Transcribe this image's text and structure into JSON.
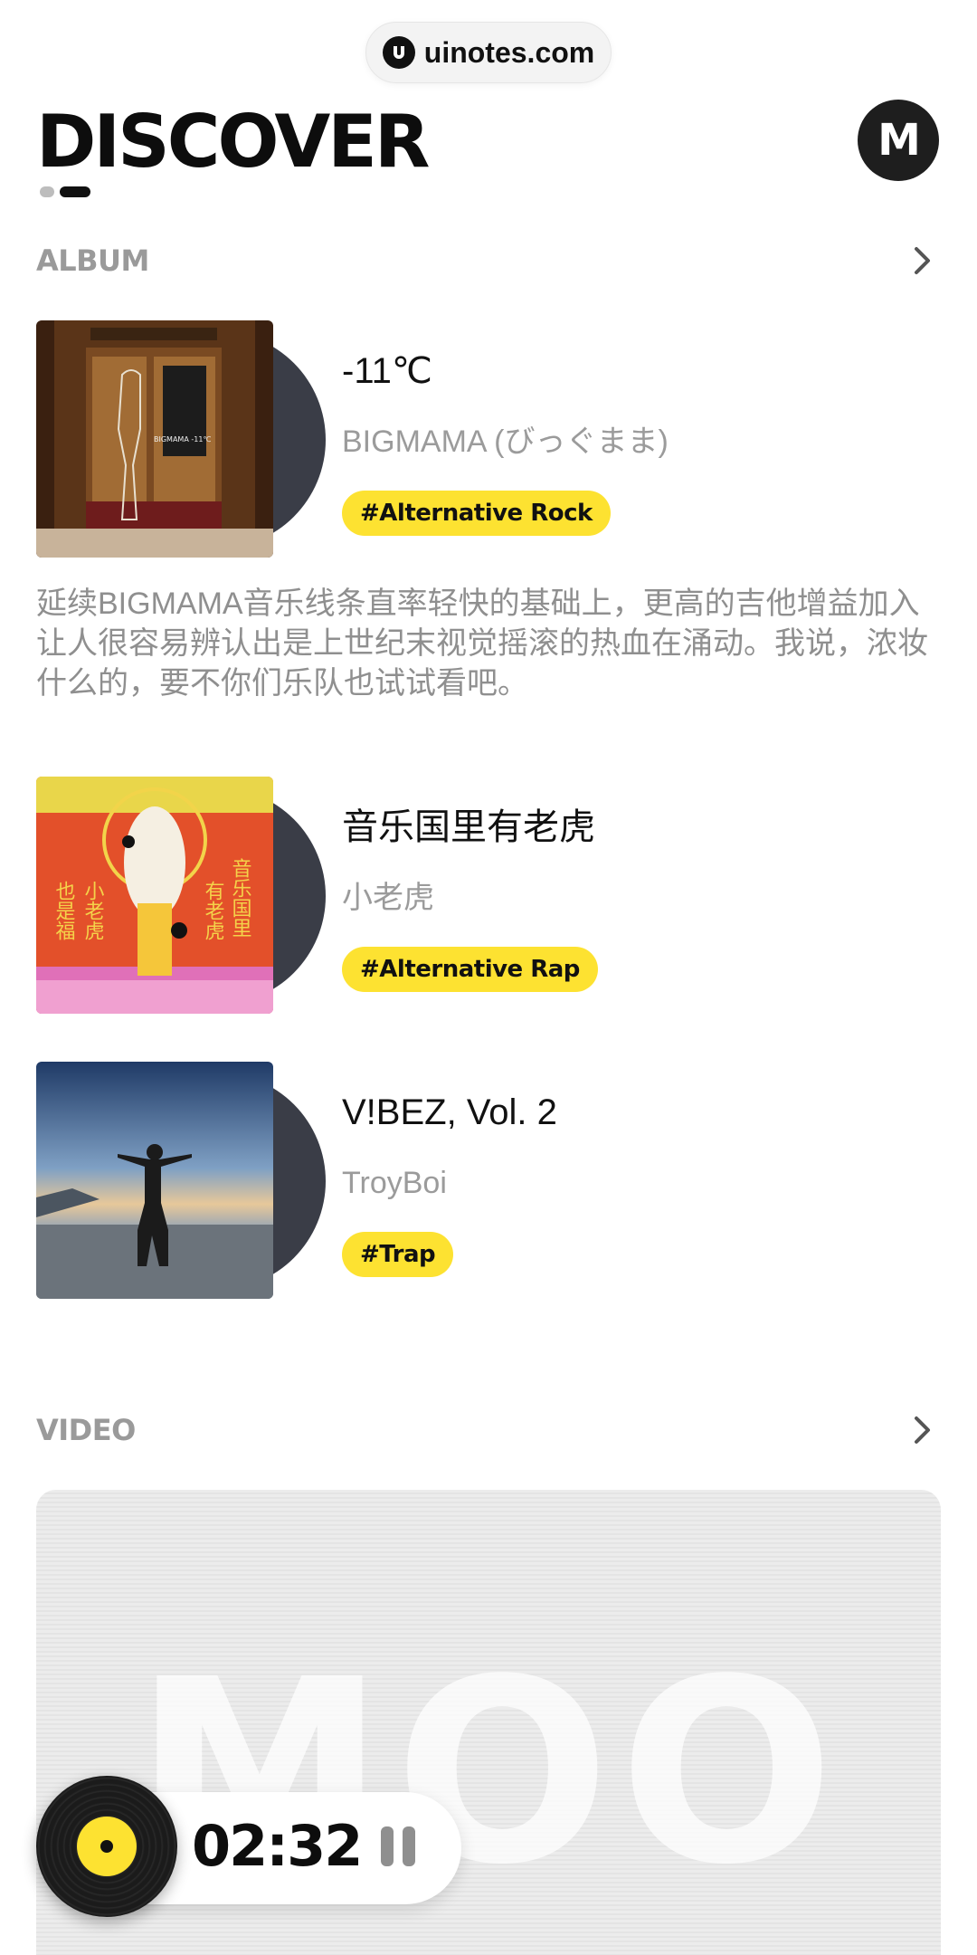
{
  "watermark": {
    "text": "uinotes.com",
    "icon": "uinotes-logo-icon"
  },
  "header": {
    "title": "DISCOVER",
    "avatar_letter": "M",
    "pager": {
      "total": 2,
      "active": 2
    }
  },
  "sections": {
    "album": {
      "title": "ALBUM",
      "more_icon": "chevron-right-icon"
    },
    "video": {
      "title": "VIDEO",
      "more_icon": "chevron-right-icon"
    }
  },
  "albums": [
    {
      "title": "-11℃",
      "artist": "BIGMAMA (びっぐまま)",
      "tag": "#Alternative Rock",
      "cover_text": "BIGMAMA -11℃",
      "description": "延续BIGMAMA音乐线条直率轻快的基础上，更高的吉他增益加入让人很容易辨认出是上世纪末视觉摇滚的热血在涌动。我说，浓妆什么的，要不你们乐队也试试看吧。"
    },
    {
      "title": "音乐国里有老虎",
      "artist": "小老虎",
      "tag": "#Alternative Rap",
      "cover_text_left": "小老虎 也是福",
      "cover_text_right": "音乐国里 有老虎"
    },
    {
      "title": "V!BEZ, Vol. 2",
      "artist": "TroyBoi",
      "tag": "#Trap"
    }
  ],
  "video": {
    "watermark_text": "MOO"
  },
  "player": {
    "time": "02:32",
    "state_icon": "pause-icon"
  },
  "colors": {
    "accent": "#fde231",
    "disc": "#3a3d47",
    "muted_text": "#9b9b9b"
  }
}
